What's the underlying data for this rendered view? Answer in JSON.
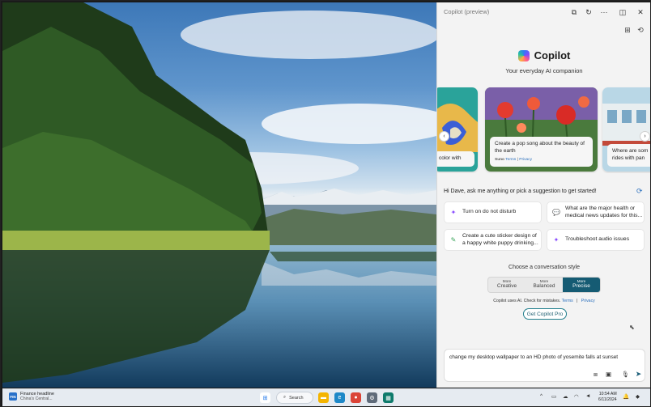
{
  "panel": {
    "title": "Copilot (preview)",
    "brand_name": "Copilot",
    "tagline": "Your everyday AI companion",
    "header_icons": [
      "open-external-icon",
      "refresh-icon",
      "more-icon",
      "dock-icon",
      "close-icon"
    ],
    "sub_icons": [
      "plugins-icon",
      "history-icon"
    ]
  },
  "carousel": {
    "cards": [
      {
        "caption": "color with"
      },
      {
        "caption": "Create a pop song about the beauty of the earth",
        "meta_brand": "Suno",
        "meta_terms": "Terms",
        "meta_sep": "|",
        "meta_privacy": "Privacy"
      },
      {
        "caption": "Where are som rides with pan"
      }
    ],
    "prev_icon": "‹",
    "next_icon": "›"
  },
  "greeting": "Hi Dave, ask me anything or pick a suggestion to get started!",
  "suggestions": [
    {
      "label": "Turn on do not disturb",
      "icon": "sparkle-icon",
      "color": "#8a4dff"
    },
    {
      "label": "What are the major health or medical news updates for this...",
      "icon": "chat-icon",
      "color": "#2a6fbd"
    },
    {
      "label": "Create a cute sticker design of a happy white puppy drinking...",
      "icon": "paint-icon",
      "color": "#3aa55b"
    },
    {
      "label": "Troubleshoot audio issues",
      "icon": "sparkle-icon",
      "color": "#8a4dff"
    }
  ],
  "style": {
    "label": "Choose a conversation style",
    "options": [
      {
        "small": "More",
        "big": "Creative"
      },
      {
        "small": "More",
        "big": "Balanced"
      },
      {
        "small": "More",
        "big": "Precise"
      }
    ],
    "active_index": 2
  },
  "disclaimer": {
    "text": "Copilot uses AI. Check for mistakes.",
    "terms": "Terms",
    "privacy": "Privacy"
  },
  "pro_button": "Get Copilot Pro",
  "compose": {
    "text": "change my desktop wallpaper to an HD photo of yosemite falls at sunset",
    "tools": [
      "screenshot-icon",
      "image-icon",
      "mic-icon",
      "send-icon"
    ]
  },
  "taskbar": {
    "news_badge": "FIN",
    "news_title": "Finance headline",
    "news_sub": "China's Central...",
    "search_label": "Search",
    "time": "10:54 AM",
    "date": "6/11/2024"
  },
  "colors": {
    "accent": "#155b73",
    "link": "#2a6fbd",
    "panel_bg": "#f3f3f3"
  }
}
